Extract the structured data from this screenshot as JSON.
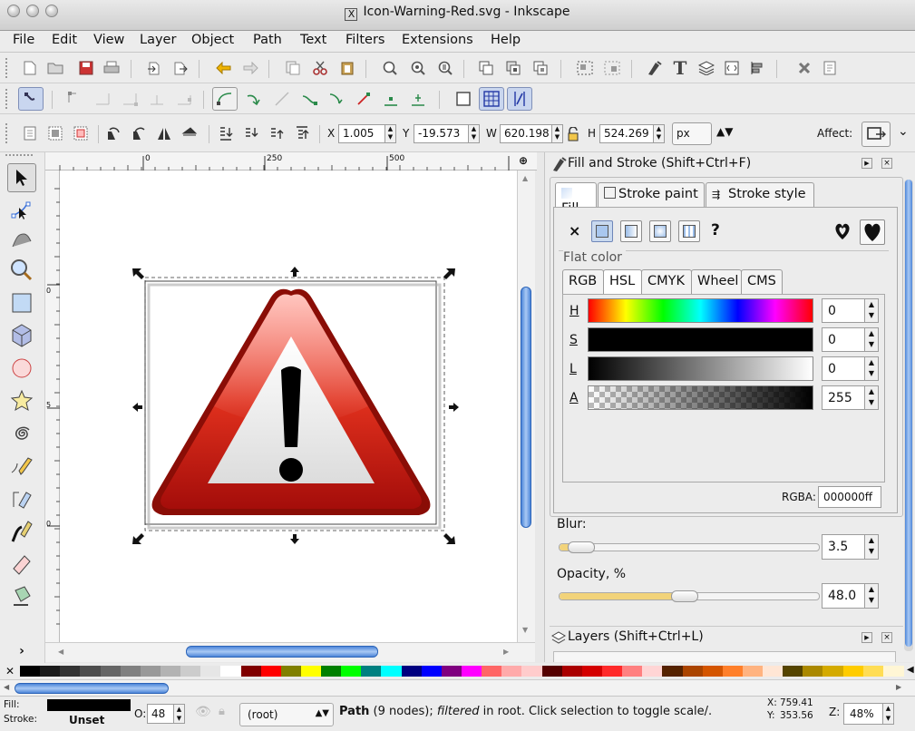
{
  "window": {
    "title": "Icon-Warning-Red.svg - Inkscape",
    "title_icon": "X"
  },
  "menubar": {
    "items": [
      "File",
      "Edit",
      "View",
      "Layer",
      "Object",
      "Path",
      "Text",
      "Filters",
      "Extensions",
      "Help"
    ]
  },
  "commands_bar": {
    "icons": [
      "new-icon",
      "open-icon",
      "save-icon",
      "print-icon",
      "import-icon",
      "export-icon",
      "undo-icon",
      "redo-icon",
      "copy-icon",
      "cut-icon",
      "paste-icon",
      "zoom-selection-icon",
      "zoom-drawing-icon",
      "zoom-page-icon",
      "duplicate-icon",
      "clone-icon",
      "unlink-clone-icon",
      "group-icon",
      "ungroup-icon",
      "fill-stroke-icon",
      "text-icon",
      "layers-icon",
      "xml-editor-icon",
      "align-icon",
      "preferences-icon",
      "document-properties-icon"
    ],
    "text_tool_glyph": "T"
  },
  "snap_bar": {
    "icons": [
      "snap-toggle-icon",
      "snap-bbox-icon",
      "snap-bbox-edge-icon",
      "snap-bbox-corner-icon",
      "snap-bbox-midpoint-icon",
      "snap-nodes-icon",
      "snap-path-icon",
      "snap-intersection-icon",
      "snap-cusp-icon",
      "snap-smooth-icon",
      "snap-midpoint-icon",
      "snap-center-icon",
      "snap-rotation-center-icon",
      "snap-page-icon",
      "snap-grid-icon",
      "snap-guide-icon"
    ]
  },
  "select_bar": {
    "x_label": "X",
    "x_value": "1.005",
    "y_label": "Y",
    "y_value": "-19.573",
    "w_label": "W",
    "w_value": "620.198",
    "h_label": "H",
    "h_value": "524.269",
    "unit": "px",
    "affect_label": "Affect:"
  },
  "ruler": {
    "top_labels": [
      "0",
      "250",
      "500"
    ],
    "left_labels": [
      "0",
      "5",
      "0"
    ]
  },
  "fill_stroke": {
    "title": "Fill and Stroke (Shift+Ctrl+F)",
    "tabs": [
      "Fill",
      "Stroke paint",
      "Stroke style"
    ],
    "active_tab": "Fill",
    "paint_none": "×",
    "paint_unset": "?",
    "section_label": "Flat color",
    "color_tabs": [
      "RGB",
      "HSL",
      "CMYK",
      "Wheel",
      "CMS"
    ],
    "active_color_tab": "HSL",
    "sliders": [
      {
        "label": "H",
        "value": "0"
      },
      {
        "label": "S",
        "value": "0"
      },
      {
        "label": "L",
        "value": "0"
      },
      {
        "label": "A",
        "value": "255"
      }
    ],
    "rgba_label": "RGBA:",
    "rgba_value": "000000ff",
    "blur_label": "Blur:",
    "blur_value": "3.5",
    "blur_fraction": 0.035,
    "opacity_label": "Opacity, %",
    "opacity_value": "48.0",
    "opacity_fraction": 0.48
  },
  "layers_panel": {
    "title": "Layers (Shift+Ctrl+L)"
  },
  "palette": {
    "colors": [
      "#000000",
      "#1a1a1a",
      "#333333",
      "#4d4d4d",
      "#666666",
      "#808080",
      "#999999",
      "#b3b3b3",
      "#cccccc",
      "#e6e6e6",
      "#ffffff",
      "#800000",
      "#ff0000",
      "#808000",
      "#ffff00",
      "#008000",
      "#00ff00",
      "#008080",
      "#00ffff",
      "#000080",
      "#0000ff",
      "#800080",
      "#ff00ff",
      "#ff6666",
      "#ffaaaa",
      "#ffcccc",
      "#550000",
      "#aa0000",
      "#d40000",
      "#ff2a2a",
      "#ff8080",
      "#ffd5d5",
      "#552200",
      "#aa4400",
      "#d45500",
      "#ff7f2a",
      "#ffb380",
      "#ffe6d5",
      "#554400",
      "#aa8800",
      "#d4aa00",
      "#ffcc00",
      "#ffdd55",
      "#fff6d5"
    ]
  },
  "statusbar": {
    "fill_label": "Fill:",
    "stroke_label": "Stroke:",
    "stroke_value": "Unset",
    "opacity_label": "O:",
    "opacity_value": "48",
    "layer_value": "(root)",
    "message_bold": "Path",
    "message_rest": " (9 nodes); ",
    "message_italic": "filtered",
    "message_tail": " in root. Click selection to toggle scale/.",
    "x_label": "X:",
    "x_value": "759.41",
    "y_label": "Y:",
    "y_value": "353.56",
    "zoom_label": "Z:",
    "zoom_value": "48%"
  },
  "colors": {
    "accent_blue": "#5b8fd4",
    "warning_red": "#d81e10"
  }
}
